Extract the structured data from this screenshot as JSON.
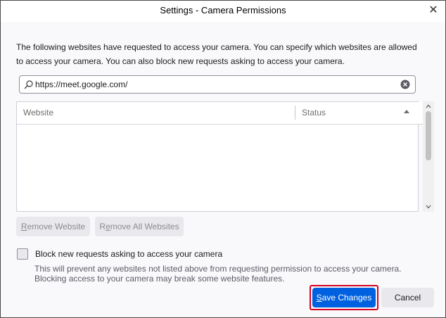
{
  "window": {
    "title": "Settings - Camera Permissions",
    "close_glyph": "✕"
  },
  "description": "The following websites have requested to access your camera. You can specify which websites are allowed to access your camera. You can also block new requests asking to access your camera.",
  "search": {
    "value": "https://meet.google.com/",
    "icon": "search-icon",
    "clear_icon": "clear-icon"
  },
  "table": {
    "columns": [
      "Website",
      "Status"
    ],
    "sort_column": "Status",
    "sort_direction": "ascending",
    "rows": []
  },
  "buttons": {
    "remove_website": {
      "access_key": "R",
      "rest": "emove Website"
    },
    "remove_all": {
      "access_key": "e",
      "pre": "R",
      "rest": "move All Websites"
    },
    "save": {
      "access_key": "S",
      "rest": "ave Changes"
    },
    "cancel": "Cancel"
  },
  "block": {
    "label": "Block new requests asking to access your camera",
    "checked": false,
    "note": "This will prevent any websites not listed above from requesting permission to access your camera. Blocking access to your camera may break some website features."
  },
  "colors": {
    "primary": "#0061e0",
    "highlight": "#d70022"
  }
}
